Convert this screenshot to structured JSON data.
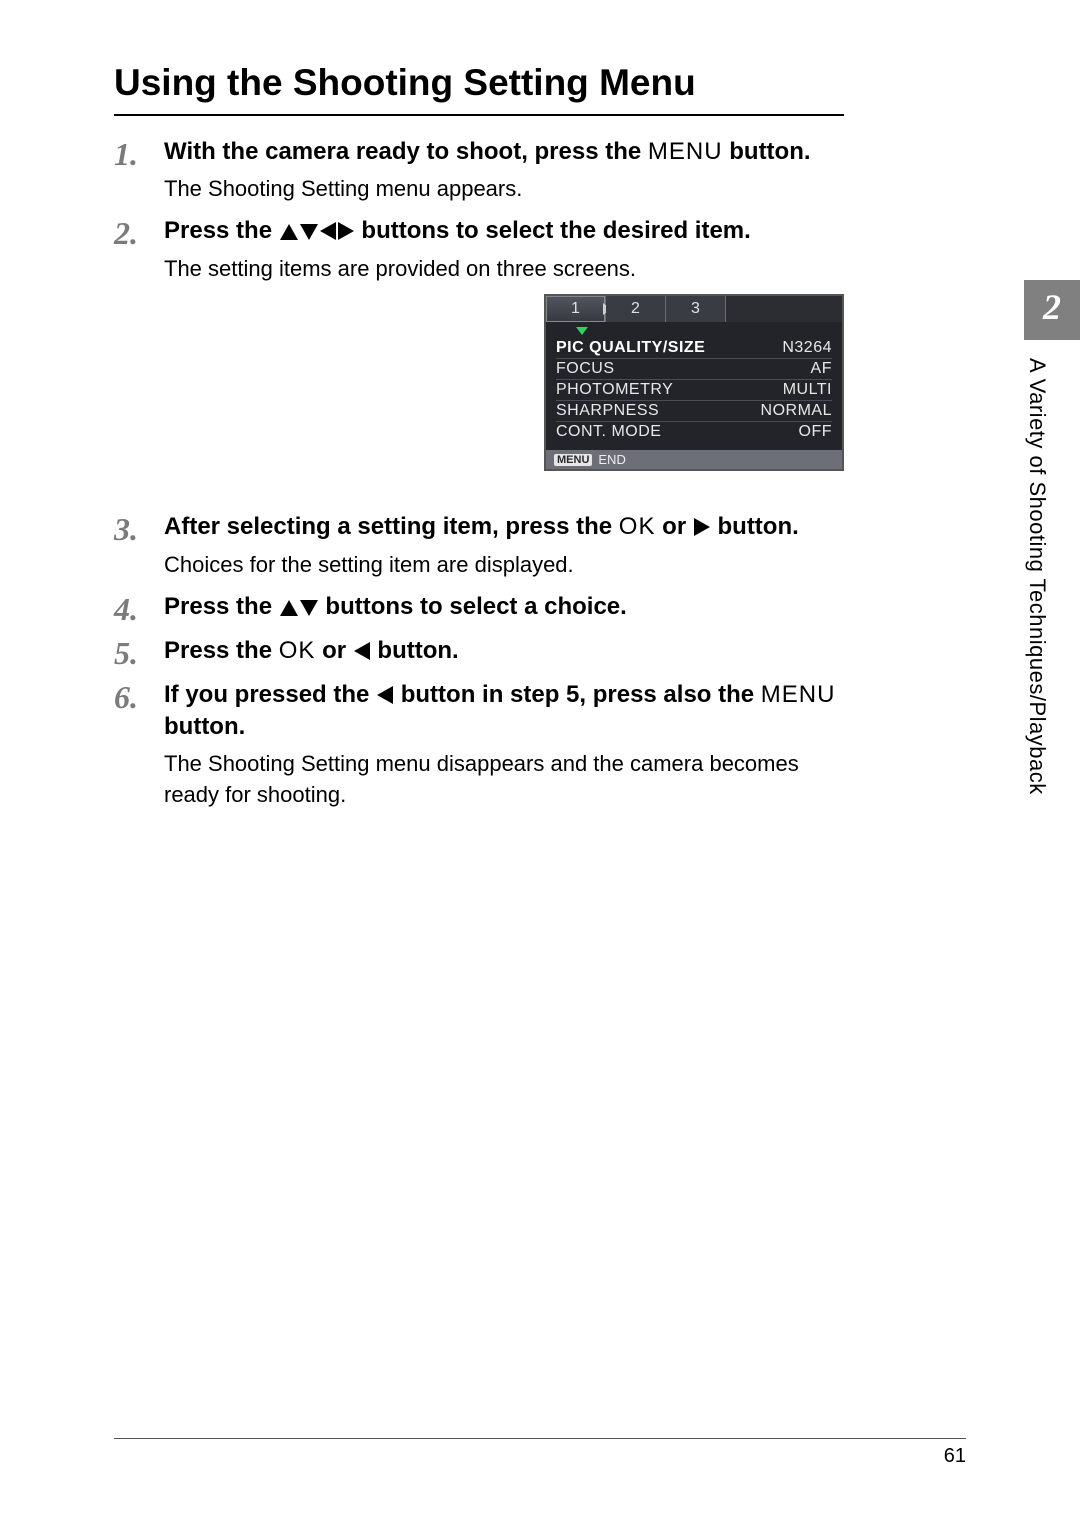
{
  "title": "Using the Shooting Setting Menu",
  "side_tab": {
    "chapter_num": "2",
    "label": "A Variety of Shooting Techniques/Playback"
  },
  "page_number": "61",
  "steps": {
    "s1": {
      "num": "1",
      "head_a": "With the camera ready to shoot, press the ",
      "head_btn": "MENU",
      "head_b": " button.",
      "sub": "The Shooting Setting menu appears."
    },
    "s2": {
      "num": "2",
      "head_a": "Press the ",
      "head_b": " buttons to select the desired item.",
      "sub": "The setting items are provided on three screens."
    },
    "s3": {
      "num": "3",
      "head_a": "After selecting a setting item, press the ",
      "head_ok": "OK",
      "head_b": " or ",
      "head_c": " button.",
      "sub": "Choices for the setting item are displayed."
    },
    "s4": {
      "num": "4",
      "head_a": "Press the ",
      "head_b": " buttons to select a choice."
    },
    "s5": {
      "num": "5",
      "head_a": "Press the ",
      "head_ok": "OK",
      "head_b": " or ",
      "head_c": " button."
    },
    "s6": {
      "num": "6",
      "head_a": "If you pressed the ",
      "head_b": " button in step 5, press also the ",
      "head_btn": "MENU",
      "head_c": " button.",
      "sub": "The Shooting Setting menu disappears and the camera becomes ready for shooting."
    }
  },
  "lcd": {
    "tabs": {
      "t1": "1",
      "t2": "2",
      "t3": "3"
    },
    "rows": [
      {
        "label": "PIC QUALITY/SIZE",
        "value": "N3264"
      },
      {
        "label": "FOCUS",
        "value": "AF"
      },
      {
        "label": "PHOTOMETRY",
        "value": "MULTI"
      },
      {
        "label": "SHARPNESS",
        "value": "NORMAL"
      },
      {
        "label": "CONT. MODE",
        "value": "OFF"
      }
    ],
    "footer_menu": "MENU",
    "footer_end": "END"
  }
}
